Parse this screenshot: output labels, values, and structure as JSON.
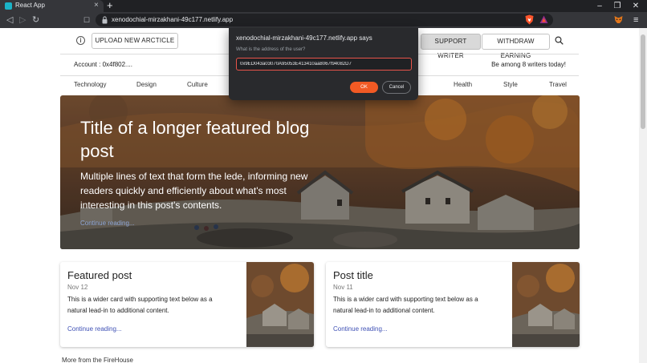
{
  "browser": {
    "tab_title": "React App",
    "tab_close": "×",
    "new_tab": "+",
    "url": "xenodochial-mirzakhani-49c177.netlify.app",
    "win_minimize": "–",
    "win_restore": "❐",
    "win_close": "✕",
    "back": "◁",
    "forward": "▷",
    "reload": "↻",
    "bookmark": "☐",
    "menu": "≡"
  },
  "header": {
    "info_glyph": "i",
    "upload_label": "UPLOAD NEW ARCTICLE",
    "support_label": "SUPPORT WRITER",
    "withdraw_label": "WITHDRAW EARNING",
    "account": "Account : 0x4f802....",
    "writers_note": "Be among 8 writers today!"
  },
  "categories": [
    "Technology",
    "Design",
    "Culture",
    "Health",
    "Style",
    "Travel"
  ],
  "hero": {
    "title": "Title of a longer featured blog post",
    "lede": "Multiple lines of text that form the lede, informing new readers quickly and efficiently about what's most interesting in this post's contents.",
    "link": "Continue reading..."
  },
  "cards": [
    {
      "title": "Featured post",
      "date": "Nov 12",
      "text": "This is a wider card with supporting text below as a natural lead-in to additional content.",
      "link": "Continue reading..."
    },
    {
      "title": "Post title",
      "date": "Nov 11",
      "text": "This is a wider card with supporting text below as a natural lead-in to additional content.",
      "link": "Continue reading..."
    }
  ],
  "more_heading": "More from the FireHouse",
  "dialog": {
    "title": "xenodochial-mirzakhani-49c177.netlify.app says",
    "message": "What is the address of the user?",
    "input_value": "0x9ED043a03070A95053E413410aa8067f94082D7",
    "ok_label": "OK",
    "cancel_label": "Cancel"
  },
  "colors": {
    "chrome_dark": "#202124",
    "chrome_tab": "#35363a",
    "dialog_bg": "#292a2d",
    "ok_orange": "#f25a24",
    "link_blue": "#3f51b5"
  }
}
